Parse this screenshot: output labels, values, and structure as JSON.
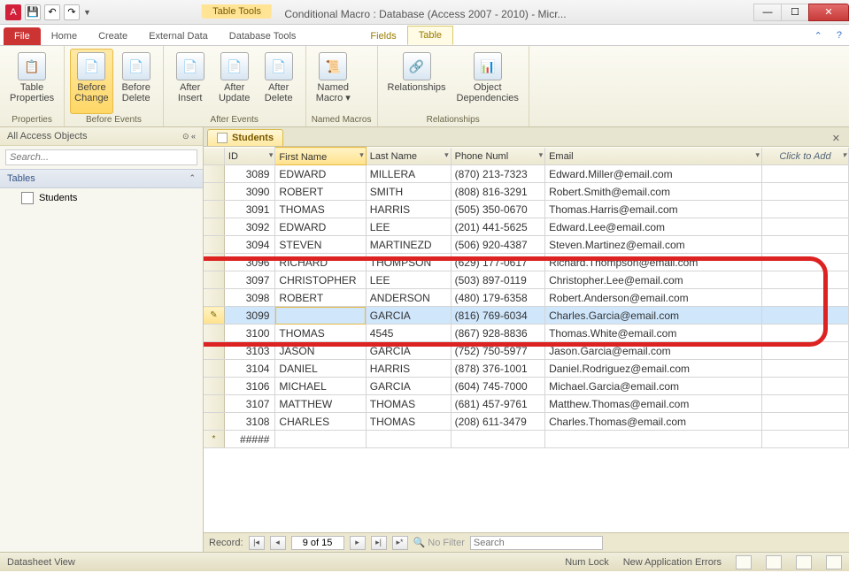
{
  "title": "Conditional Macro : Database (Access 2007 - 2010)  -  Micr...",
  "contextGroup": "Table Tools",
  "tabs": {
    "file": "File",
    "home": "Home",
    "create": "Create",
    "external": "External Data",
    "dbtools": "Database Tools",
    "fields": "Fields",
    "table": "Table"
  },
  "ribbon": {
    "properties": {
      "tableProps": "Table\nProperties",
      "group": "Properties"
    },
    "beforeEvents": {
      "beforeChange": "Before\nChange",
      "beforeDelete": "Before\nDelete",
      "group": "Before Events"
    },
    "afterEvents": {
      "afterInsert": "After\nInsert",
      "afterUpdate": "After\nUpdate",
      "afterDelete": "After\nDelete",
      "group": "After Events"
    },
    "namedMacros": {
      "namedMacro": "Named\nMacro ▾",
      "group": "Named Macros"
    },
    "relationships": {
      "relationships": "Relationships",
      "objDeps": "Object\nDependencies",
      "group": "Relationships"
    }
  },
  "nav": {
    "header": "All Access Objects",
    "searchPlaceholder": "Search...",
    "section": "Tables",
    "items": [
      "Students"
    ]
  },
  "docTab": "Students",
  "columns": {
    "id": "ID",
    "first": "First Name",
    "last": "Last Name",
    "phone": "Phone Numl",
    "email": "Email",
    "add": "Click to Add"
  },
  "rows": [
    {
      "id": "3089",
      "first": "EDWARD",
      "last": "MILLERA",
      "phone": "(870) 213-7323",
      "email": "Edward.Miller@email.com"
    },
    {
      "id": "3090",
      "first": "ROBERT",
      "last": "SMITH",
      "phone": "(808) 816-3291",
      "email": "Robert.Smith@email.com"
    },
    {
      "id": "3091",
      "first": "THOMAS",
      "last": "HARRIS",
      "phone": "(505) 350-0670",
      "email": "Thomas.Harris@email.com"
    },
    {
      "id": "3092",
      "first": "EDWARD",
      "last": "LEE",
      "phone": "(201) 441-5625",
      "email": "Edward.Lee@email.com"
    },
    {
      "id": "3094",
      "first": "STEVEN",
      "last": "MARTINEZD",
      "phone": "(506) 920-4387",
      "email": "Steven.Martinez@email.com"
    },
    {
      "id": "3096",
      "first": "RICHARD",
      "last": "THOMPSON",
      "phone": "(629) 177-0617",
      "email": "Richard.Thompson@email.com"
    },
    {
      "id": "3097",
      "first": "CHRISTOPHER",
      "last": "LEE",
      "phone": "(503) 897-0119",
      "email": "Christopher.Lee@email.com"
    },
    {
      "id": "3098",
      "first": "ROBERT",
      "last": "ANDERSON",
      "phone": "(480) 179-6358",
      "email": "Robert.Anderson@email.com"
    },
    {
      "id": "3099",
      "first": "",
      "last": "GARCIA",
      "phone": "(816) 769-6034",
      "email": "Charles.Garcia@email.com",
      "sel": true,
      "editing": true
    },
    {
      "id": "3100",
      "first": "THOMAS",
      "last": "4545",
      "phone": "(867) 928-8836",
      "email": "Thomas.White@email.com"
    },
    {
      "id": "3103",
      "first": "JASON",
      "last": "GARCIA",
      "phone": "(752) 750-5977",
      "email": "Jason.Garcia@email.com"
    },
    {
      "id": "3104",
      "first": "DANIEL",
      "last": "HARRIS",
      "phone": "(878) 376-1001",
      "email": "Daniel.Rodriguez@email.com"
    },
    {
      "id": "3106",
      "first": "MICHAEL",
      "last": "GARCIA",
      "phone": "(604) 745-7000",
      "email": "Michael.Garcia@email.com"
    },
    {
      "id": "3107",
      "first": "MATTHEW",
      "last": "THOMAS",
      "phone": "(681) 457-9761",
      "email": "Matthew.Thomas@email.com"
    },
    {
      "id": "3108",
      "first": "CHARLES",
      "last": "THOMAS",
      "phone": "(208) 611-3479",
      "email": "Charles.Thomas@email.com"
    }
  ],
  "newRow": "#####",
  "recordNav": {
    "label": "Record:",
    "pos": "9 of 15",
    "filter": "No Filter",
    "search": "Search"
  },
  "status": {
    "view": "Datasheet View",
    "numlock": "Num Lock",
    "errors": "New Application Errors"
  }
}
